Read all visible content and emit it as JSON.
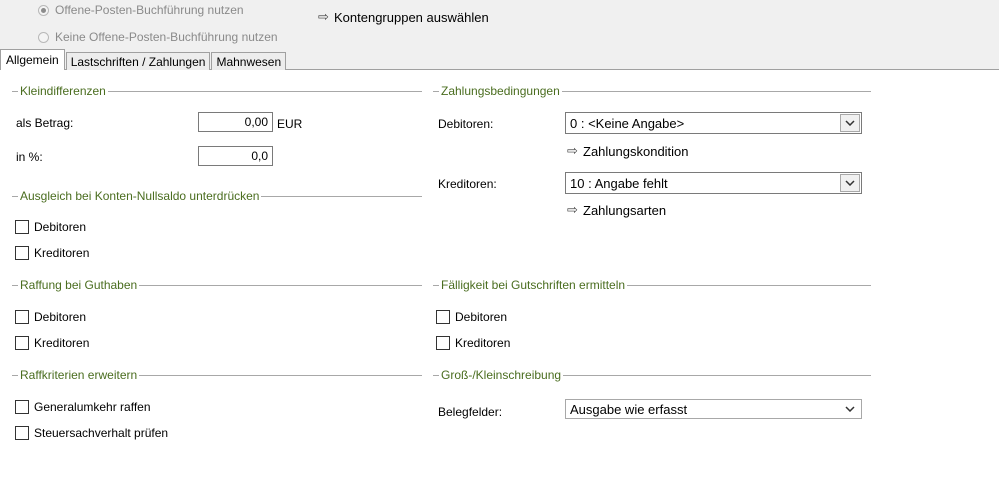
{
  "top": {
    "radio1": "Offene-Posten-Buchführung nutzen",
    "radio2": "Keine Offene-Posten-Buchführung nutzen",
    "link_kontengruppen": "Kontengruppen auswählen"
  },
  "tabs": [
    "Allgemein",
    "Lastschriften / Zahlungen",
    "Mahnwesen"
  ],
  "kleindifferenzen": {
    "title": "Kleindifferenzen",
    "betrag_label": "als Betrag:",
    "betrag_value": "0,00",
    "betrag_unit": "EUR",
    "prozent_label": "in %:",
    "prozent_value": "0,0"
  },
  "ausgleich": {
    "title": "Ausgleich bei Konten-Nullsaldo unterdrücken",
    "debitoren": "Debitoren",
    "kreditoren": "Kreditoren"
  },
  "raffung": {
    "title": "Raffung bei Guthaben",
    "debitoren": "Debitoren",
    "kreditoren": "Kreditoren"
  },
  "raffkriterien": {
    "title": "Raffkriterien erweitern",
    "generalumkehr": "Generalumkehr raffen",
    "steuersachverhalt": "Steuersachverhalt prüfen"
  },
  "zahlungsbedingungen": {
    "title": "Zahlungsbedingungen",
    "debitoren_label": "Debitoren:",
    "debitoren_value": "0 : <Keine Angabe>",
    "link_zahlungskondition": "Zahlungskondition",
    "kreditoren_label": "Kreditoren:",
    "kreditoren_value": "10 : Angabe fehlt",
    "link_zahlungsarten": "Zahlungsarten"
  },
  "faelligkeit": {
    "title": "Fälligkeit bei Gutschriften ermitteln",
    "debitoren": "Debitoren",
    "kreditoren": "Kreditoren"
  },
  "schreibung": {
    "title": "Groß-/Kleinschreibung",
    "belegfelder_label": "Belegfelder:",
    "belegfelder_value": "Ausgabe wie erfasst"
  }
}
